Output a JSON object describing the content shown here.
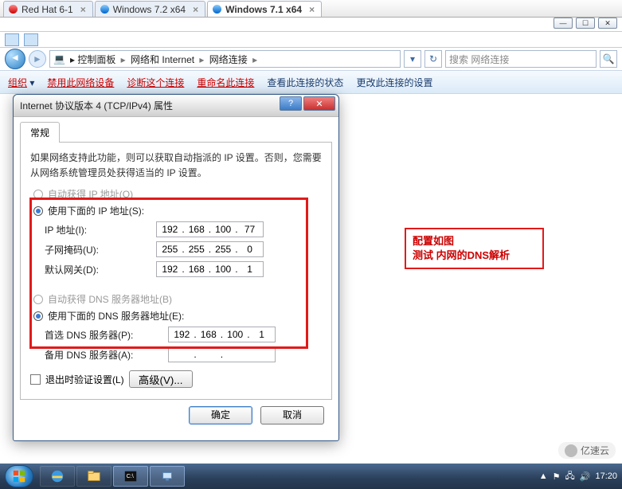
{
  "vm_tabs": [
    {
      "label": "Red Hat 6-1",
      "active": false,
      "color": "r"
    },
    {
      "label": "Windows 7.2 x64",
      "active": false,
      "color": "b"
    },
    {
      "label": "Windows 7.1 x64",
      "active": true,
      "color": "b"
    }
  ],
  "breadcrumb": {
    "p1": "控制面板",
    "p2": "网络和 Internet",
    "p3": "网络连接"
  },
  "search_placeholder": "搜索 网络连接",
  "explorer_menu": {
    "m1": "组织",
    "m2": "禁用此网络设备",
    "m3": "诊断这个连接",
    "m4": "重命名此连接",
    "m5": "查看此连接的状态",
    "m6": "更改此连接的设置"
  },
  "dialog": {
    "title": "Internet 协议版本 4 (TCP/IPv4) 属性",
    "tab": "常规",
    "hint": "如果网络支持此功能，则可以获取自动指派的 IP 设置。否则，您需要从网络系统管理员处获得适当的 IP 设置。",
    "opt_auto_ip": "自动获得 IP 地址(O)",
    "opt_manual_ip": "使用下面的 IP 地址(S):",
    "ip_label": "IP 地址(I):",
    "mask_label": "子网掩码(U):",
    "gw_label": "默认网关(D):",
    "ip": {
      "a": "192",
      "b": "168",
      "c": "100",
      "d": "77"
    },
    "mask": {
      "a": "255",
      "b": "255",
      "c": "255",
      "d": "0"
    },
    "gw": {
      "a": "192",
      "b": "168",
      "c": "100",
      "d": "1"
    },
    "opt_auto_dns": "自动获得 DNS 服务器地址(B)",
    "opt_manual_dns": "使用下面的 DNS 服务器地址(E):",
    "dns1_label": "首选 DNS 服务器(P):",
    "dns2_label": "备用 DNS 服务器(A):",
    "dns1": {
      "a": "192",
      "b": "168",
      "c": "100",
      "d": "1"
    },
    "dns2": {
      "a": "",
      "b": ".",
      "c": ".",
      "d": ""
    },
    "validate": "退出时验证设置(L)",
    "advanced": "高级(V)...",
    "ok": "确定",
    "cancel": "取消"
  },
  "annotation": {
    "line1": "配置如图",
    "line2": "测试 内网的DNS解析"
  },
  "taskbar": {
    "time": "17:20"
  },
  "watermark": "亿速云"
}
